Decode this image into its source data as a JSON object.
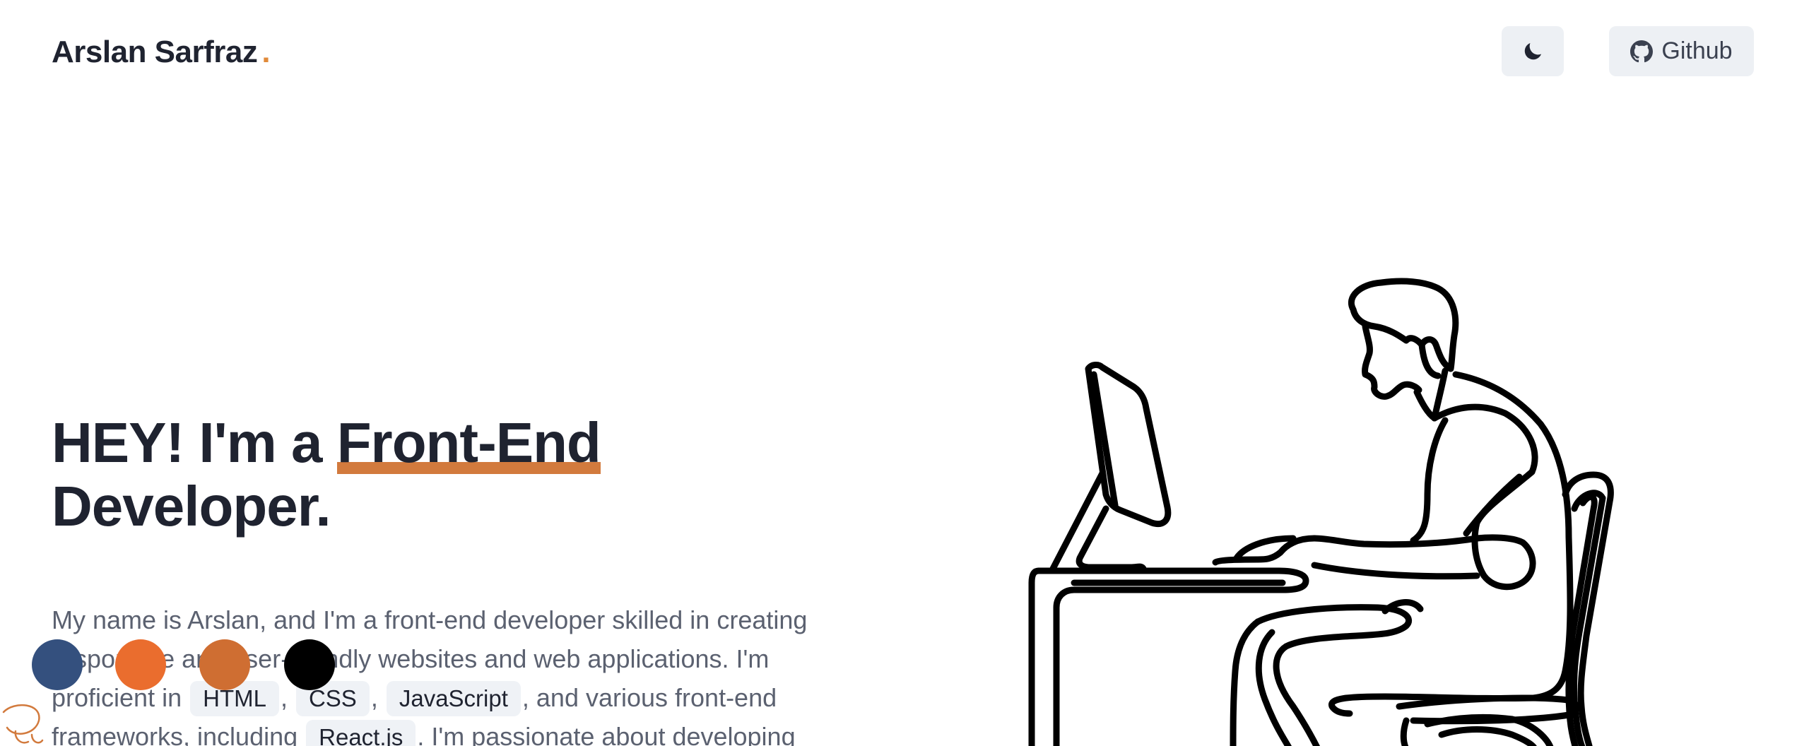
{
  "header": {
    "brand_name": "Arslan Sarfraz",
    "brand_dot": ".",
    "theme_toggle_icon": "moon-icon",
    "github_label": "Github",
    "github_icon": "github-icon"
  },
  "hero": {
    "headline_before": "HEY! I'm a ",
    "headline_highlight": "Front-End",
    "headline_after": "Developer.",
    "para_1": "My name is Arslan, and I'm a front-end developer skilled in creating responsive and user-friendly websites and web applications. I'm proficient in ",
    "tag_html": "HTML",
    "sep_1": ", ",
    "tag_css": "CSS",
    "sep_2": ", ",
    "tag_js": "JavaScript",
    "para_2": ", and various front-end frameworks, including ",
    "tag_react": "React.js",
    "para_3": ". I'm passionate about developing"
  },
  "color_swatches": [
    "#34507e",
    "#ea6d2e",
    "#cf6e32",
    "#000000"
  ],
  "colors": {
    "accent": "#d27a3d",
    "brand_dot": "#e08a3a",
    "button_bg": "#edf0f4",
    "text_dark": "#1f2330",
    "text_muted": "#5b6170"
  },
  "illustration_icon": "developer-at-computer-line-art"
}
